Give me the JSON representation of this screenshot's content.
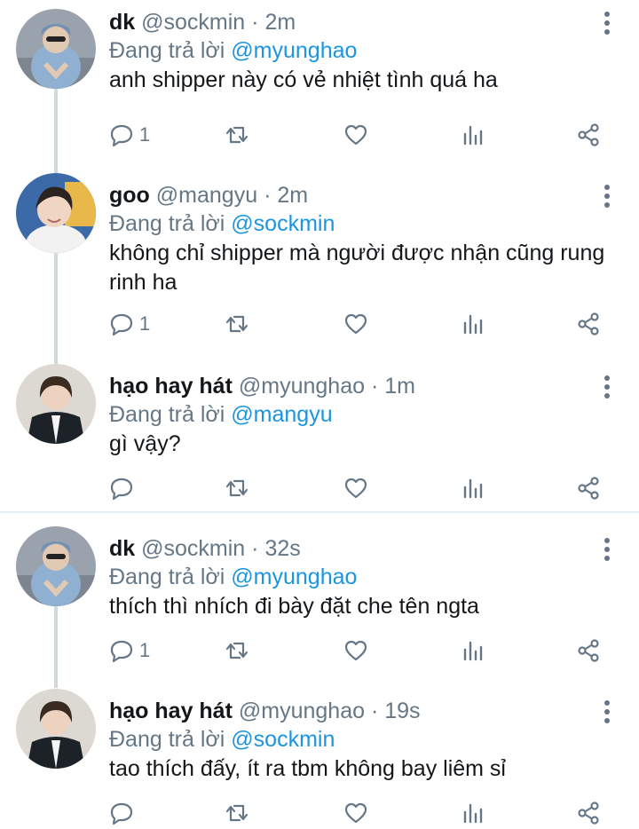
{
  "reply_prefix": "Đang trả lời",
  "tweets": [
    {
      "name": "dk",
      "handle": "@sockmin",
      "dot": "·",
      "time": "2m",
      "reply_to": "@myunghao",
      "text": "anh shipper này có vẻ nhiệt tình quá ha",
      "reply_count": "1"
    },
    {
      "name": "goo",
      "handle": "@mangyu",
      "dot": "·",
      "time": "2m",
      "reply_to": "@sockmin",
      "text": "không chỉ shipper mà người được nhận cũng rung rinh ha",
      "reply_count": "1"
    },
    {
      "name": "hạo hay hát",
      "handle": "@myunghao",
      "dot": "·",
      "time": "1m",
      "reply_to": "@mangyu",
      "text": "gì vậy?",
      "reply_count": ""
    },
    {
      "name": "dk",
      "handle": "@sockmin",
      "dot": "·",
      "time": "32s",
      "reply_to": "@myunghao",
      "text": "thích thì nhích đi bày đặt che tên ngta",
      "reply_count": "1"
    },
    {
      "name": "hạo hay hát",
      "handle": "@myunghao",
      "dot": "·",
      "time": "19s",
      "reply_to": "@sockmin",
      "text": "tao thích đấy, ít ra tbm không bay liêm sỉ",
      "reply_count": ""
    }
  ],
  "icons": {
    "reply": "reply-icon",
    "retweet": "retweet-icon",
    "like": "heart-icon",
    "analytics": "analytics-icon",
    "share": "share-icon",
    "more": "more-vertical-icon"
  },
  "colors": {
    "text": "#14171a",
    "secondary": "#657786",
    "mention": "#1b95e0",
    "divider": "#e6ecf0",
    "thread_line": "#cfd9de"
  }
}
